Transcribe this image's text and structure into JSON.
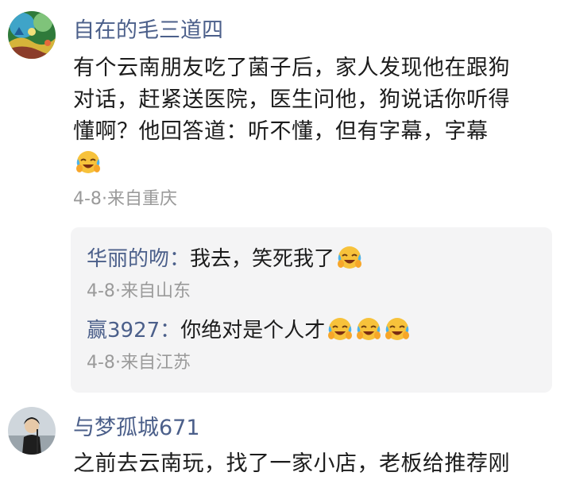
{
  "comments": [
    {
      "username": "自在的毛三道四",
      "content_lines": [
        "有个云南朋友吃了菌子后，家人发现他在跟狗",
        "对话，赶紧送医院，医生问他，狗说话你听得",
        "懂啊？他回答道：听不懂，但有字幕，字幕"
      ],
      "emoji": "laughing-crying-emoji",
      "date": "4-8",
      "location": "来自重庆",
      "replies": [
        {
          "username": "华丽的吻",
          "separator": "：",
          "text": "我去，笑死我了",
          "emoji_count": 1,
          "date": "4-8",
          "location": "来自山东"
        },
        {
          "username": "赢3927",
          "separator": "：",
          "text": "你绝对是个人才",
          "emoji_count": 3,
          "date": "4-8",
          "location": "来自江苏"
        }
      ]
    },
    {
      "username": "与梦孤城671",
      "content_lines": [
        "之前去云南玩，找了一家小店，老板给推荐刚"
      ]
    }
  ],
  "meta_separator": "·",
  "colors": {
    "username": "#4b5f8a",
    "meta": "#9a9a9a",
    "reply_box": "#f4f4f5"
  }
}
